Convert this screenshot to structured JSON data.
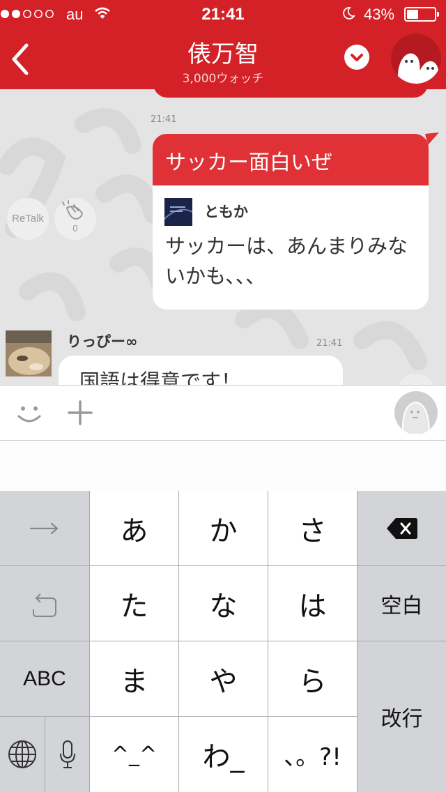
{
  "status_bar": {
    "carrier": "au",
    "time": "21:41",
    "battery_percent": "43%",
    "battery_level": 0.43,
    "signal_bars_filled": 2,
    "signal_bars_total": 5
  },
  "nav": {
    "title": "俵万智",
    "subtitle": "3,000ウォッチ"
  },
  "chat": {
    "sent_message": {
      "time": "21:41",
      "text": "サッカー面白いぜ",
      "quoted_user": "ともか",
      "quoted_text": "サッカーは、あんまりみないかも、、、"
    },
    "retalk_label": "ReTalk",
    "clap_count": "0",
    "received_message": {
      "user": "りっぴー∞",
      "time": "21:41",
      "text": "国語は得意です！"
    }
  },
  "keyboard": {
    "keys": {
      "a": "あ",
      "ka": "か",
      "sa": "さ",
      "ta": "た",
      "na": "な",
      "ha": "は",
      "ma": "ま",
      "ya": "や",
      "ra": "ら",
      "face": "^_^",
      "wa": "わ_",
      "punct": "、。?!",
      "space": "空白",
      "abc": "ABC",
      "return": "改行"
    }
  },
  "colors": {
    "brand_red": "#d42027",
    "bubble_header_red": "#df3136",
    "chat_background": "#e4e4e4"
  }
}
